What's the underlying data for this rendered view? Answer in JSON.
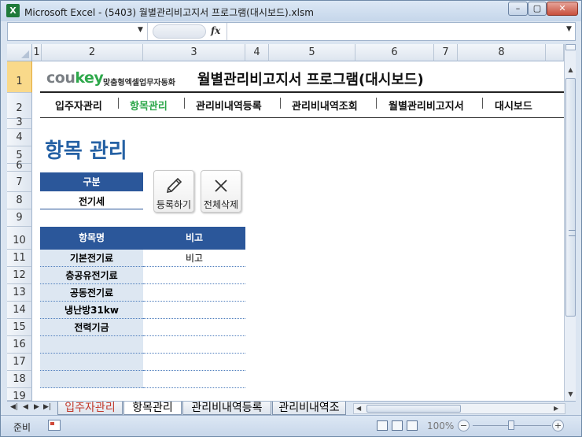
{
  "window": {
    "title": "Microsoft Excel - (5403) 월별관리비고지서 프로그램(대시보드).xlsm",
    "app_icon": "X",
    "controls": {
      "minimize": "–",
      "maximize": "▢",
      "close": "✕"
    }
  },
  "formula_bar": {
    "name_box": "",
    "fx": "fx",
    "content": ""
  },
  "columns": [
    "1",
    "2",
    "3",
    "4",
    "5",
    "6",
    "7",
    "8"
  ],
  "rows": [
    "1",
    "2",
    "3",
    "4",
    "5",
    "6",
    "7",
    "8",
    "9",
    "10",
    "11",
    "12",
    "13",
    "14",
    "15",
    "16",
    "17",
    "18",
    "19"
  ],
  "header": {
    "logo_cou": "cou",
    "logo_key": "key",
    "logo_tagline": "맞춤형엑셀업무자동화",
    "program_title": "월별관리비고지서 프로그램(대시보드)"
  },
  "nav": [
    {
      "label": "입주자관리",
      "active": false
    },
    {
      "label": "항목관리",
      "active": true
    },
    {
      "label": "관리비내역등록",
      "active": false
    },
    {
      "label": "관리비내역조회",
      "active": false
    },
    {
      "label": "월별관리비고지서",
      "active": false
    },
    {
      "label": "대시보드",
      "active": false
    }
  ],
  "page": {
    "heading": "항목 관리",
    "category_header": "구분",
    "category_value": "전기세",
    "register_button": "등록하기",
    "delete_all_button": "전체삭제"
  },
  "table": {
    "headers": [
      "항목명",
      "비고"
    ],
    "rows": [
      [
        "기본전기료",
        "비고"
      ],
      [
        "층공유전기료",
        ""
      ],
      [
        "공동전기료",
        ""
      ],
      [
        "냉난방31kw",
        ""
      ],
      [
        "전력기금",
        ""
      ],
      [
        "",
        ""
      ],
      [
        "",
        ""
      ],
      [
        "",
        ""
      ]
    ]
  },
  "sheet_tabs": [
    {
      "label": "입주자관리",
      "active": false
    },
    {
      "label": "항목관리",
      "active": true
    },
    {
      "label": "관리비내역등록",
      "active": false
    },
    {
      "label": "관리비내역조",
      "active": false
    }
  ],
  "status": {
    "ready": "준비",
    "zoom": "100%"
  },
  "colors": {
    "accent_blue": "#2b579a",
    "brand_green": "#2ea84b",
    "heading_blue": "#2561a4",
    "light_cell": "#dde7f2"
  }
}
